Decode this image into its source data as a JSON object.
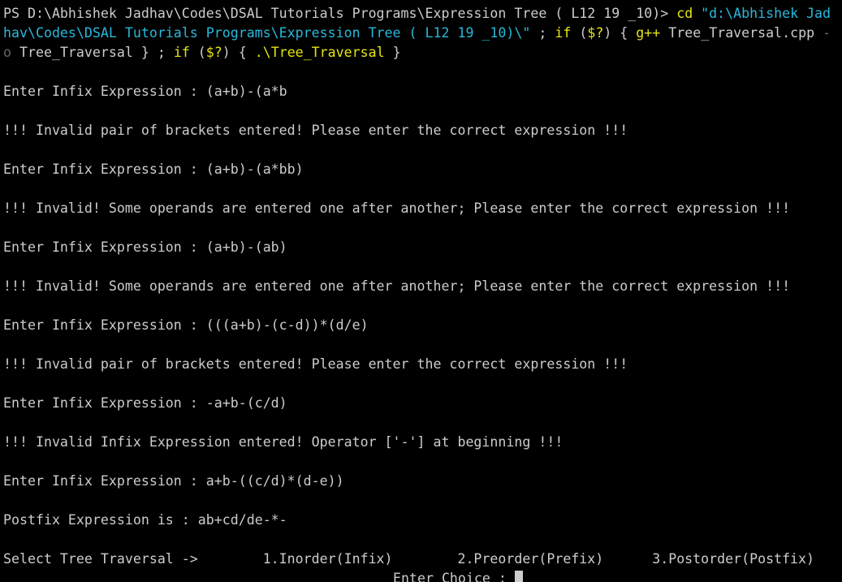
{
  "terminal": {
    "cmd": {
      "line1": {
        "prompt": "PS D:\\Abhishek Jadhav\\Codes\\DSAL Tutorials Programs\\Expression Tree ( L12 19 _10)> ",
        "cd": "cd",
        "path_start": " \"d:\\Abhishek Jad"
      },
      "line2": {
        "path_end": "hav\\Codes\\DSAL Tutorials Programs\\Expression Tree ( L12 19 _10)\\\"",
        "sep1": " ; ",
        "if1": "if",
        "cond1_open": " (",
        "cond1": "$?",
        "cond1_close": ") { ",
        "gpp": "g++",
        "src": " Tree_Traversal.cpp",
        "dash": " -"
      },
      "line3": {
        "o": "o",
        "out_name": " Tree_Traversal } ; ",
        "if2": "if",
        "cond2_open": " (",
        "cond2": "$?",
        "cond2_close": ") { ",
        "run": ".\\Tree_Traversal",
        "close": " }"
      }
    },
    "lines": [
      "Enter Infix Expression : (a+b)-(a*b",
      "!!! Invalid pair of brackets entered! Please enter the correct expression !!!",
      "Enter Infix Expression : (a+b)-(a*bb)",
      "!!! Invalid! Some operands are entered one after another; Please enter the correct expression !!!",
      "Enter Infix Expression : (a+b)-(ab)",
      "!!! Invalid! Some operands are entered one after another; Please enter the correct expression !!!",
      "Enter Infix Expression : (((a+b)-(c-d))*(d/e)",
      "!!! Invalid pair of brackets entered! Please enter the correct expression !!!",
      "Enter Infix Expression : -a+b-(c/d)",
      "!!! Invalid Infix Expression entered! Operator ['-'] at beginning !!!",
      "Enter Infix Expression : a+b-((c/d)*(d-e))",
      "Postfix Expression is : ab+cd/de-*-",
      "Select Tree Traversal ->        1.Inorder(Infix)        2.Preorder(Prefix)      3.Postorder(Postfix)"
    ],
    "choice_prompt": "Enter Choice : "
  },
  "colors": {
    "background": "#000000",
    "text": "#cccccc",
    "command_yellow": "#e5e510",
    "string_cyan": "#29b8db",
    "dim_gray": "#666666"
  }
}
